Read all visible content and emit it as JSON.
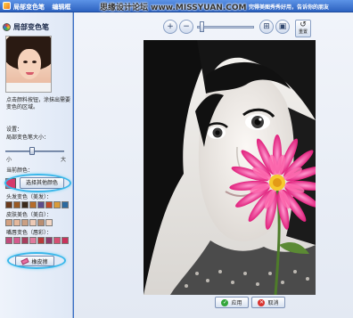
{
  "window": {
    "title_parts": [
      "局部变色笔",
      "编辑框"
    ],
    "promo_text": "完得美图秀秀好用，告诉你的朋友",
    "watermark": "思缘设计论坛 www.MISSYUAN.COM"
  },
  "sidebar": {
    "header": "局部变色笔",
    "instructions": "点击颜料按钮，涂抹出需要变色的区域。",
    "settings_label": "设置：",
    "brush_size_label": "局部变色笔大小：",
    "brush_size_value": 0.45,
    "slider_min": "小",
    "slider_max": "大",
    "current_color_label": "当前颜色：",
    "current_color": "#d43a6a",
    "choose_color_button": "选择其他颜色",
    "palette_labels": [
      "头发变色（美发）：",
      "皮肤美色（美白）：",
      "嘴唇变色（唇彩）："
    ],
    "palettes": [
      [
        "#6b3a1c",
        "#9a5a24",
        "#3b2b1c",
        "#b56c2a",
        "#5d4c8c",
        "#c04a2a",
        "#d89b3a",
        "#2c6aa0"
      ],
      [
        "#d3a080",
        "#e4b89c",
        "#caa084",
        "#ecc9b5",
        "#b98e72",
        "#f2d6c4"
      ],
      [
        "#c04b7b",
        "#d55a8e",
        "#a83d5e",
        "#e07a9d",
        "#b83a3a",
        "#8e3a6c",
        "#d64f73",
        "#c8325c"
      ]
    ],
    "eraser_button": "橡皮擦"
  },
  "toolbar": {
    "zoom_in_icon": "zoom-in-icon",
    "zoom_out_icon": "zoom-out-icon",
    "zoom_level": 0.05,
    "reset_label": "重置"
  },
  "actions": {
    "apply_label": "应用",
    "cancel_label": "取消"
  }
}
